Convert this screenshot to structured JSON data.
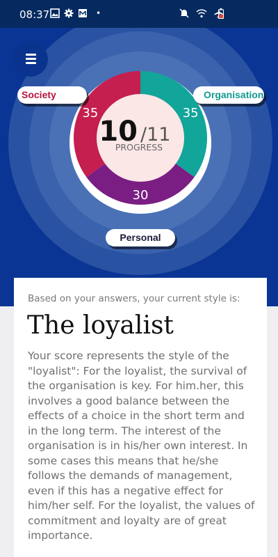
{
  "status_bar": {
    "time": "08:37",
    "dot": "•",
    "left_icons": [
      "image-icon",
      "gear-icon",
      "mail-icon"
    ],
    "right_icons": [
      "mute-icon",
      "wifi-icon",
      "airplane-icon",
      "battery-icon"
    ]
  },
  "menu": {
    "icon": "hamburger-menu-icon"
  },
  "chart_data": {
    "type": "pie",
    "segments": [
      {
        "label": "Organisation",
        "value": 35,
        "color": "#12a59a"
      },
      {
        "label": "Personal",
        "value": 30,
        "color": "#7a1e84"
      },
      {
        "label": "Society",
        "value": 35,
        "color": "#c41f4f"
      }
    ],
    "center_value": "10",
    "center_total": "/11",
    "center_label": "PROGRESS",
    "center_color": "#fbe7e6"
  },
  "labels": {
    "society": "Society",
    "organisation": "Organisation",
    "personal": "Personal"
  },
  "card": {
    "intro": "Based on your answers, your current style is:",
    "title": "The loyalist",
    "description": "Your score represents the style of the \"loyalist\": For the loyalist, the survival of the organisation is key. For him.her, this involves a good balance between the effects of a choice in the short term and in the long term. The interest of the organisation is in his/her own interest. In some cases this means that he/she follows the demands of management, even if this has a negative effect for him/her self. For the loyalist, the values of commitment and loyalty are of great importance."
  },
  "colors": {
    "status_bar": "#062a60",
    "hero_background": "#0a3594",
    "page_background": "#efeff2",
    "society": "#b8123c",
    "organisation": "#0f9a8f"
  }
}
